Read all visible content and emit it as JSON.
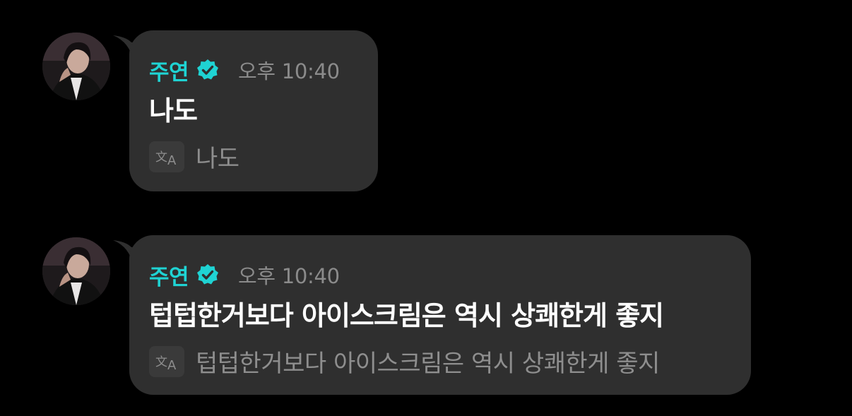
{
  "colors": {
    "background": "#000000",
    "bubble": "#2f2f2f",
    "sender_name": "#1fd3d3",
    "verified_badge": "#1fd3d3",
    "timestamp": "#8b8b8b",
    "message_text": "#ffffff",
    "translation_text": "#8e8e8e"
  },
  "messages": [
    {
      "sender": "주연",
      "verified": true,
      "verified_icon": "verified-badge-icon",
      "time": "오후 10:40",
      "text": "나도",
      "translation_icon": "translate-icon",
      "translation": "나도"
    },
    {
      "sender": "주연",
      "verified": true,
      "verified_icon": "verified-badge-icon",
      "time": "오후 10:40",
      "text": "텁텁한거보다 아이스크림은 역시 상쾌한게 좋지",
      "translation_icon": "translate-icon",
      "translation": "텁텁한거보다 아이스크림은 역시 상쾌한게 좋지"
    }
  ]
}
